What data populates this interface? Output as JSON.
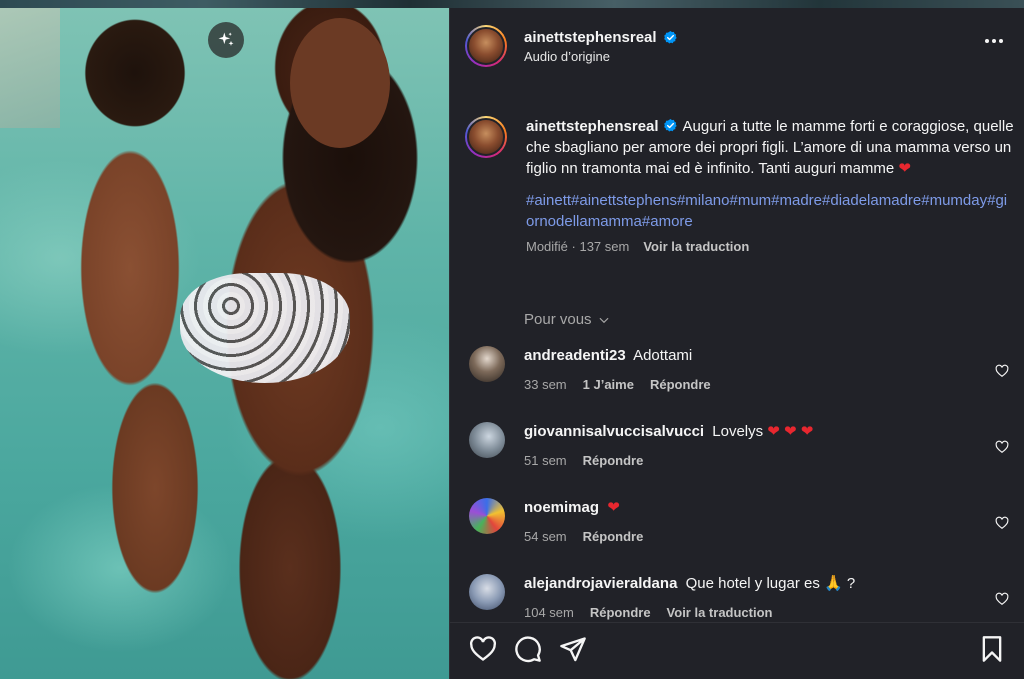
{
  "post": {
    "username": "ainettstephensreal",
    "audio": "Audio d’origine",
    "caption": "Auguri a tutte le mamme forti e coraggiose, quelle che sbagliano per amore dei propri figli. L’amore di una mamma verso un figlio nn tramonta mai ed è infinito. Tanti auguri mamme",
    "hashtags": "#ainett#ainettstephens#milano#mum#madre#diadelamadre#mumday#giornodellamamma#amore",
    "modified": "Modifié · 137 sem",
    "translate": "Voir la traduction"
  },
  "section": {
    "pour_vous": "Pour vous"
  },
  "comments": [
    {
      "username": "andreadenti23",
      "text": "Adottami",
      "time": "33 sem",
      "likes": "1 J’aime",
      "reply": "Répondre"
    },
    {
      "username": "giovannisalvuccisalvucci",
      "text": "Lovelys",
      "time": "51 sem",
      "reply": "Répondre"
    },
    {
      "username": "noemimag",
      "text": "",
      "time": "54 sem",
      "reply": "Répondre"
    },
    {
      "username": "alejandrojavieraldana",
      "text": "Que hotel y lugar es",
      "text_suffix": "?",
      "time": "104 sem",
      "reply": "Répondre",
      "translate": "Voir la traduction"
    }
  ],
  "colors": {
    "panel_bg": "#212228",
    "link": "#7e9be8",
    "muted": "#a8a8a8",
    "verified": "#0095f6",
    "heart": "#e8272f"
  },
  "icons": [
    "sparkle-icon",
    "verified-icon",
    "more-icon",
    "chevron-down-icon",
    "heart-outline-icon",
    "comment-icon",
    "share-icon",
    "bookmark-icon",
    "red-heart-emoji",
    "pray-emoji"
  ]
}
